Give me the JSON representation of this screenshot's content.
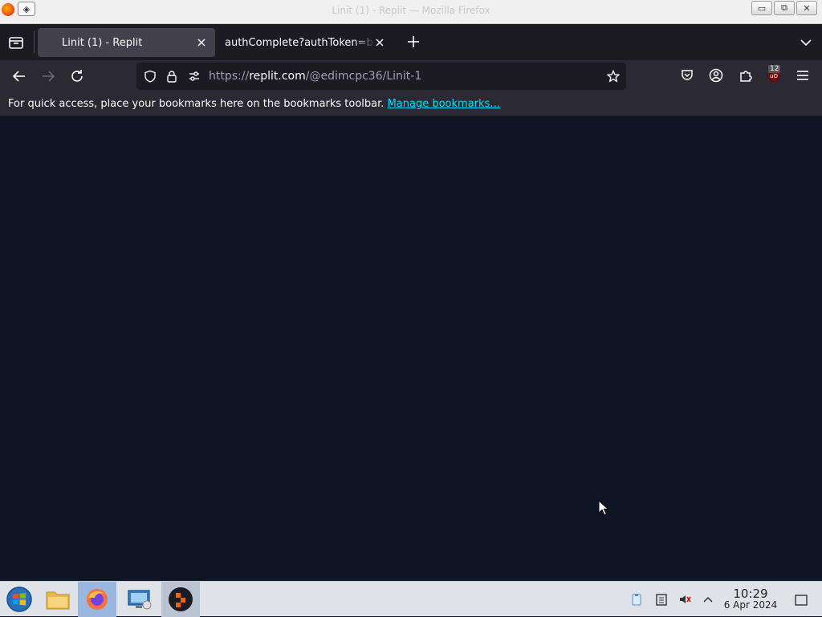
{
  "window": {
    "title": "Linit (1) - Replit — Mozilla Firefox",
    "app_icon": "firefox-icon"
  },
  "tabs": [
    {
      "label": "Linit (1) - Replit",
      "active": true
    },
    {
      "label": "authComplete?authToken=b",
      "active": false
    }
  ],
  "urlbar": {
    "scheme": "https://",
    "host": "replit.com",
    "path": "/@edimcpc36/Linit-1"
  },
  "toolbar": {
    "extension_badge": "12"
  },
  "bookmarks_bar": {
    "message": "For quick access, place your bookmarks here on the bookmarks toolbar.",
    "link": "Manage bookmarks…"
  },
  "taskbar": {
    "apps": [
      "start-menu",
      "file-manager",
      "firefox",
      "remote-desktop",
      "replit"
    ],
    "clock_time": "10:29",
    "clock_date": "6 Apr 2024"
  },
  "colors": {
    "content_bg": "#0e1525",
    "tabstrip_bg": "#1c1b22",
    "navbar_bg": "#2b2a33",
    "link": "#00ddff"
  }
}
